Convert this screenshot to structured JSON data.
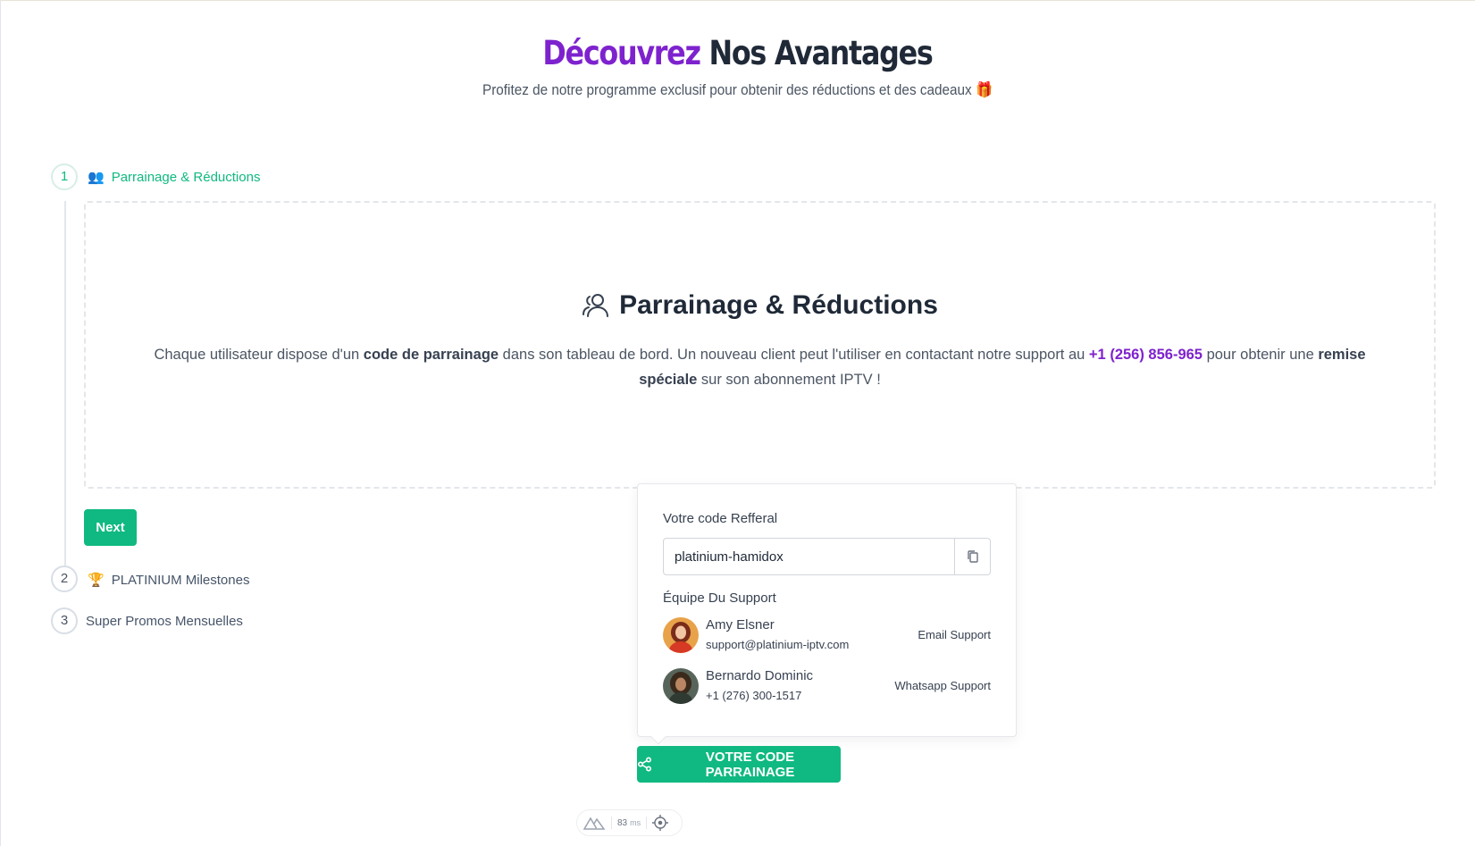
{
  "hero": {
    "title_accent": "Découvrez",
    "title_rest": " Nos Avantages",
    "subtitle": "Profitez de notre programme exclusif pour obtenir des réductions et des cadeaux 🎁"
  },
  "steps": [
    {
      "number": "1",
      "icon": "👥",
      "label": "Parrainage & Réductions",
      "active": true
    },
    {
      "number": "2",
      "icon": "🏆",
      "label": "PLATINIUM Milestones",
      "active": false
    },
    {
      "number": "3",
      "icon": "",
      "label": "Super Promos Mensuelles",
      "active": false
    }
  ],
  "panel": {
    "icon": "users-icon",
    "title": "Parrainage & Réductions",
    "text_1": "Chaque utilisateur dispose d'un ",
    "text_bold_1": "code de parrainage",
    "text_2": " dans son tableau de bord. Un nouveau client peut l'utiliser en contactant notre support au ",
    "phone": "+1 (256) 856-965",
    "text_3": " pour obtenir une ",
    "text_bold_2": "remise spéciale",
    "text_4": " sur son abonnement IPTV !"
  },
  "next_label": "Next",
  "popover": {
    "code_label": "Votre code Refferal",
    "code_value": "platinium-hamidox",
    "support_label": "Équipe Du Support",
    "contacts": [
      {
        "name": "Amy Elsner",
        "detail": "support@platinium-iptv.com",
        "link": "Email Support"
      },
      {
        "name": "Bernardo Dominic",
        "detail": "+1 (276) 300-1517",
        "link": "Whatsapp Support"
      }
    ]
  },
  "cta_label": "VOTRE CODE PARRAINAGE",
  "perf": {
    "value": "83",
    "unit": "ms"
  },
  "colors": {
    "accent_green": "#10b981",
    "accent_purple": "#7e22ce"
  }
}
